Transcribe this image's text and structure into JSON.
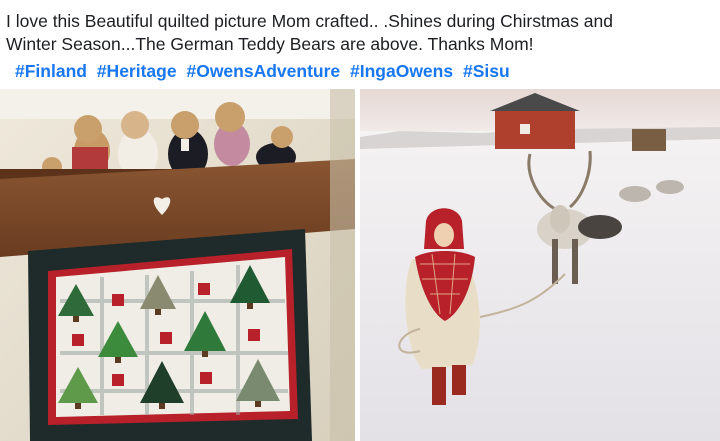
{
  "post": {
    "caption_line1": "I love this Beautiful quilted picture Mom crafted.. .Shines during Chirstmas and",
    "caption_line2": "Winter Season...The German Teddy Bears are above.   Thanks Mom!",
    "hashtags": [
      "#Finland",
      "#Heritage",
      "#OwensAdventure",
      "#IngaOwens",
      "#Sisu"
    ]
  },
  "colors": {
    "hashtag": "#1877f2",
    "text": "#1c1e21",
    "quilt_border": "#1f2a2a",
    "quilt_red": "#b8202a",
    "tree_green": "#2f6b3a",
    "shelf_wood": "#7a4a2a"
  },
  "photos": [
    {
      "name": "quilt-photo",
      "icons": [
        "teddy-bear",
        "tree",
        "heart"
      ]
    },
    {
      "name": "reindeer-photo",
      "icons": [
        "reindeer",
        "child",
        "cabin"
      ]
    }
  ]
}
